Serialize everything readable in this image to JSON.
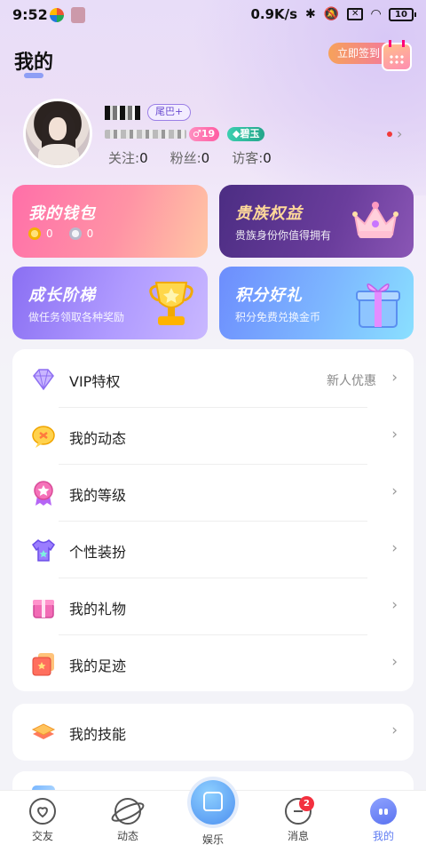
{
  "status_bar": {
    "time": "9:52",
    "network_speed": "0.9K/s",
    "battery": "10"
  },
  "header": {
    "title": "我的",
    "checkin_label": "立即签到"
  },
  "profile": {
    "tail_badge": "尾巴+",
    "level": "19",
    "jade_badge": "碧玉",
    "stats": [
      {
        "label": "关注:",
        "value": "0"
      },
      {
        "label": "粉丝:",
        "value": "0"
      },
      {
        "label": "访客:",
        "value": "0"
      }
    ]
  },
  "cards": {
    "wallet": {
      "title": "我的钱包",
      "gold": "0",
      "silver": "0"
    },
    "noble": {
      "title": "贵族权益",
      "subtitle": "贵族身份你值得拥有"
    },
    "growth": {
      "title": "成长阶梯",
      "subtitle": "做任务领取各种奖励"
    },
    "points": {
      "title": "积分好礼",
      "subtitle": "积分免费兑换金币"
    }
  },
  "menu": {
    "items": [
      {
        "label": "VIP特权",
        "extra": "新人优惠",
        "icon": "diamond-icon"
      },
      {
        "label": "我的动态",
        "icon": "chat-bubble-icon"
      },
      {
        "label": "我的等级",
        "icon": "medal-icon"
      },
      {
        "label": "个性装扮",
        "icon": "shirt-icon"
      },
      {
        "label": "我的礼物",
        "icon": "gift-box-icon"
      },
      {
        "label": "我的足迹",
        "icon": "footprint-card-icon"
      }
    ],
    "skill": {
      "label": "我的技能",
      "icon": "layers-icon"
    }
  },
  "bottom_nav": {
    "items": [
      {
        "label": "交友",
        "icon": "heart-icon"
      },
      {
        "label": "动态",
        "icon": "planet-icon"
      },
      {
        "label": "娱乐",
        "icon": "home-icon"
      },
      {
        "label": "消息",
        "icon": "message-icon",
        "badge": "2"
      },
      {
        "label": "我的",
        "icon": "face-icon"
      }
    ]
  },
  "colors": {
    "accent": "#5f7cf2",
    "badge_red": "#f3303f"
  }
}
